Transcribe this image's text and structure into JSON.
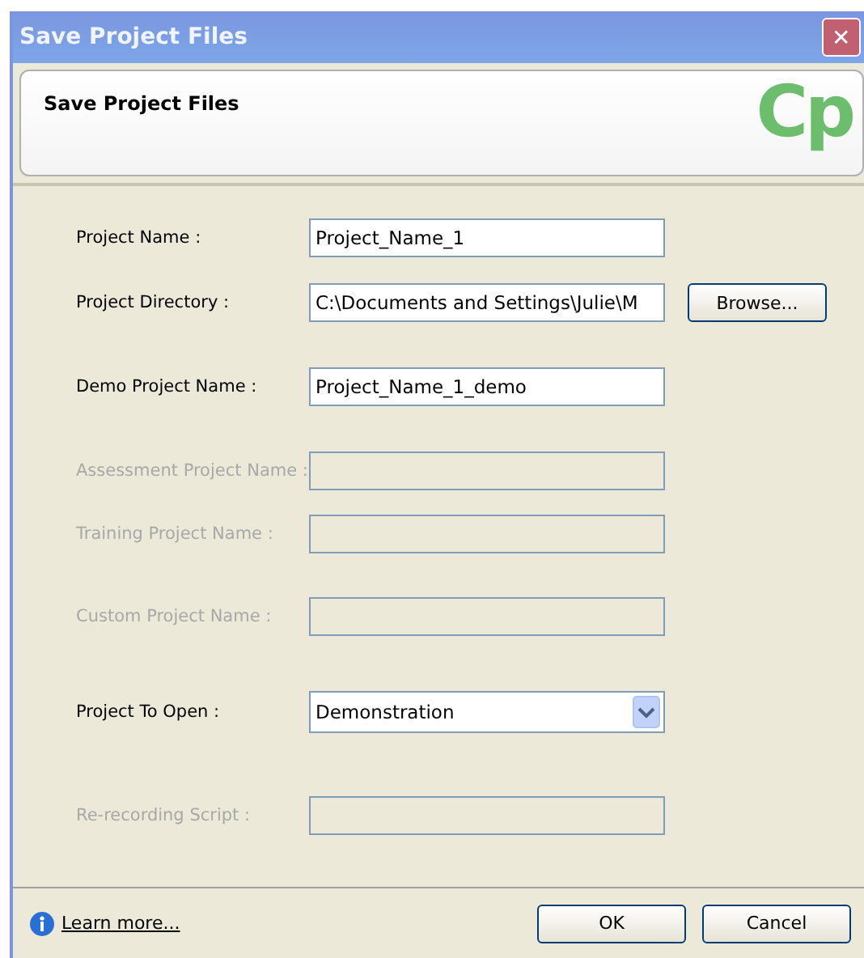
{
  "window": {
    "title": "Save Project Files",
    "close": "✕"
  },
  "header": {
    "title": "Save Project Files",
    "logo": "Cp"
  },
  "fields": [
    {
      "kind": "text",
      "label": "Project Name :",
      "value": "Project_Name_1",
      "disabled": false
    },
    {
      "kind": "text",
      "label": "Project Directory :",
      "value": "C:\\Documents and Settings\\Julie\\M",
      "disabled": false,
      "button": "Browse..."
    },
    {
      "kind": "text",
      "label": "Demo Project Name :",
      "value": "Project_Name_1_demo",
      "disabled": false
    },
    {
      "kind": "text",
      "label": "Assessment Project Name :",
      "disabled": true
    },
    {
      "kind": "text",
      "label": "Training Project Name :",
      "disabled": true
    },
    {
      "kind": "text",
      "label": "Custom Project Name :",
      "disabled": true
    },
    {
      "kind": "dropdown",
      "label": "Project To Open :",
      "value": "Demonstration",
      "disabled": false
    },
    {
      "kind": "text",
      "label": "Re-recording Script :",
      "disabled": true
    }
  ],
  "footer": {
    "link": "Learn more...",
    "buttons": [
      "OK",
      "Cancel"
    ]
  }
}
